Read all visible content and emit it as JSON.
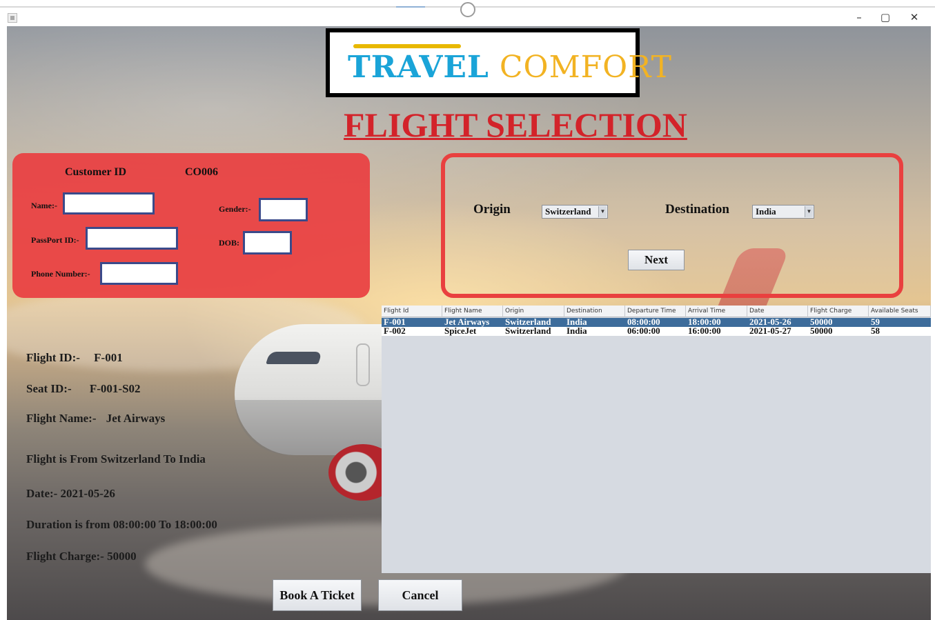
{
  "window": {
    "minimize": "–",
    "maximize": "▢",
    "close": "✕"
  },
  "logo": {
    "word1": "TRAVEL",
    "word2": "COMFORT"
  },
  "page_title": "FLIGHT SELECTION",
  "customer": {
    "id_label": "Customer ID",
    "id_value": "CO006",
    "name_label": "Name:-",
    "gender_label": "Gender:-",
    "passport_label": "PassPort ID:-",
    "dob_label": "DOB:",
    "phone_label": "Phone Number:-",
    "name_value": "",
    "gender_value": "",
    "passport_value": "",
    "dob_value": "",
    "phone_value": ""
  },
  "route": {
    "origin_label": "Origin",
    "origin_value": "Switzerland",
    "destination_label": "Destination",
    "destination_value": "India",
    "next_label": "Next"
  },
  "table": {
    "columns": [
      "Flight Id",
      "Flight Name",
      "Origin",
      "Destination",
      "Departure Time",
      "Arrival Time",
      "Date",
      "Flight Charge",
      "Available Seats"
    ],
    "rows": [
      [
        "F-001",
        "Jet Airways",
        "Switzerland",
        "India",
        "08:00:00",
        "18:00:00",
        "2021-05-26",
        "50000",
        "59"
      ],
      [
        "F-002",
        "SpiceJet",
        "Switzerland",
        "India",
        "06:00:00",
        "16:00:00",
        "2021-05-27",
        "50000",
        "58"
      ]
    ],
    "selected_row": 0
  },
  "info": {
    "flight_id_label": "Flight ID:-",
    "flight_id_value": "F-001",
    "seat_id_label": "Seat ID:-",
    "seat_id_value": "F-001-S02",
    "flight_name_label": "Flight Name:-",
    "flight_name_value": "Jet Airways",
    "route_text": "Flight is From Switzerland To India",
    "date_text": "Date:- 2021-05-26",
    "duration_text": "Duration is from  08:00:00 To 18:00:00",
    "charge_text": "Flight Charge:- 50000"
  },
  "actions": {
    "book_label": "Book A Ticket",
    "cancel_label": "Cancel"
  },
  "colors": {
    "panel_red": "#e93f42",
    "title_red": "#d3232a",
    "logo_blue": "#1aa4d8",
    "logo_gold": "#f2b323",
    "selection_blue": "#3d6c9b"
  }
}
